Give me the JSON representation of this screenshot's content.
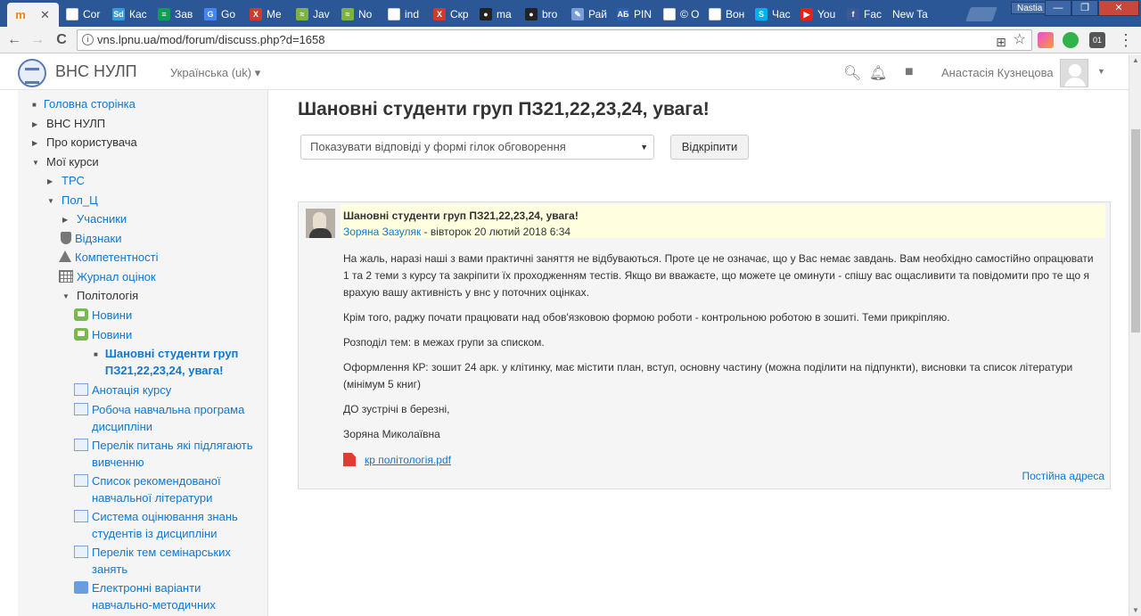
{
  "browser": {
    "tabs": [
      {
        "label": "",
        "icon": "moodle-icon",
        "color": "#f98012",
        "glyph": "m",
        "active": true
      },
      {
        "label": "Cor",
        "icon": "document-icon",
        "color": "#ffffff",
        "glyph": ""
      },
      {
        "label": "Кас",
        "icon": "sd-icon",
        "color": "#3a9ad9",
        "glyph": "Sd"
      },
      {
        "label": "Зав",
        "icon": "sheets-icon",
        "color": "#0f9d58",
        "glyph": "≡"
      },
      {
        "label": "Go",
        "icon": "google-translate-icon",
        "color": "#4285f4",
        "glyph": "G"
      },
      {
        "label": "Me",
        "icon": "x-icon",
        "color": "#d23a2c",
        "glyph": "X"
      },
      {
        "label": "Jav",
        "icon": "learn-icon",
        "color": "#7cb342",
        "glyph": "≈"
      },
      {
        "label": "No",
        "icon": "learn-icon",
        "color": "#7cb342",
        "glyph": "≈"
      },
      {
        "label": "ind",
        "icon": "document-icon",
        "color": "#ffffff",
        "glyph": ""
      },
      {
        "label": "Скр",
        "icon": "x-icon",
        "color": "#d23a2c",
        "glyph": "X"
      },
      {
        "label": "ma",
        "icon": "github-icon",
        "color": "#222222",
        "glyph": "●"
      },
      {
        "label": "bro",
        "icon": "github-icon",
        "color": "#222222",
        "glyph": "●"
      },
      {
        "label": "Рай",
        "icon": "pen-icon",
        "color": "#7a9ed8",
        "glyph": "✎"
      },
      {
        "label": "PIN",
        "icon": "ab-icon",
        "color": "#2b5fb3",
        "glyph": "АБ"
      },
      {
        "label": "© Ο",
        "icon": "document-icon",
        "color": "#ffffff",
        "glyph": ""
      },
      {
        "label": "Вон",
        "icon": "document-icon",
        "color": "#ffffff",
        "glyph": ""
      },
      {
        "label": "Час",
        "icon": "skype-icon",
        "color": "#00aff0",
        "glyph": "S"
      },
      {
        "label": "You",
        "icon": "youtube-icon",
        "color": "#e62117",
        "glyph": "▶"
      },
      {
        "label": "Fac",
        "icon": "facebook-icon",
        "color": "#3b5998",
        "glyph": "f"
      },
      {
        "label": "New Ta",
        "icon": "",
        "color": "",
        "glyph": ""
      }
    ],
    "user_badge": "Nastia",
    "window_buttons": [
      "—",
      "❐",
      "✕"
    ],
    "url": "vns.lpnu.ua/mod/forum/discuss.php?d=1658",
    "nav_back": "←",
    "nav_forward": "→",
    "nav_reload": "C",
    "info_glyph": "i",
    "omni_translate_glyph": "⊞",
    "omni_star_glyph": "☆",
    "ext_label_01": "01",
    "menu_glyph": "⋮"
  },
  "topbar": {
    "brand": "ВНС НУЛП",
    "language": "Українська (uk) ▾",
    "user_name": "Анастасія Кузнецова",
    "search_glyph": "🔍︎",
    "bell_glyph": "🔔︎",
    "chat_glyph": "■",
    "caret_glyph": "▼"
  },
  "sidebar": {
    "items": [
      {
        "label": "Головна сторінка",
        "kind": "bullet"
      },
      {
        "label": "ВНС НУЛП",
        "kind": "collapsed"
      },
      {
        "label": "Про користувача",
        "kind": "collapsed"
      },
      {
        "label": "Мої курси",
        "kind": "expanded"
      },
      {
        "label": "ТРС",
        "kind": "collapsed"
      },
      {
        "label": "Пол_Ц",
        "kind": "expanded"
      },
      {
        "label": "Учасники",
        "kind": "collapsed"
      },
      {
        "label": "Відзнаки",
        "icon": "trophy-icon"
      },
      {
        "label": "Компетентності",
        "icon": "competency-icon"
      },
      {
        "label": "Журнал оцінок",
        "icon": "gradebook-icon"
      },
      {
        "label": "Політологія",
        "kind": "expanded"
      },
      {
        "label": "Новини",
        "icon": "forum-icon"
      },
      {
        "label": "Новини",
        "icon": "forum-icon"
      },
      {
        "label": "Шановні студенти груп ПЗ21,22,23,24, увага!",
        "kind": "current"
      },
      {
        "label": "Анотація курсу",
        "icon": "page-icon"
      },
      {
        "label": "Робоча навчальна програма дисципліни",
        "icon": "page-icon"
      },
      {
        "label": "Перелік питань які підлягають вивченню",
        "icon": "page-icon"
      },
      {
        "label": "Список рекомендованої навчальної літератури",
        "icon": "page-icon"
      },
      {
        "label": "Система оцінювання знань студентів із дисципліни",
        "icon": "page-icon"
      },
      {
        "label": "Перелік тем семінарських занять",
        "icon": "page-icon"
      },
      {
        "label": "Електронні варіанти навчально-методичних",
        "icon": "folder-icon"
      }
    ],
    "glyphs": {
      "collapsed": "▶",
      "expanded": "▼",
      "bullet": "■"
    }
  },
  "main": {
    "title": "Шановні студенти груп ПЗ21,22,23,24, увага!",
    "display_mode": "Показувати відповіді у формі гілок обговорення",
    "display_mode_arrow": "▼",
    "pin_button": "Відкріпити",
    "post": {
      "subject": "Шановні студенти груп ПЗ21,22,23,24, увага!",
      "author": "Зоряна Зазуляк",
      "date": " - вівторок 20 лютий 2018 6:34",
      "paragraphs": [
        "На жаль, наразі наші з вами практичні заняття не відбуваються. Проте це не означає, що у Вас немає завдань. Вам необхідно самостійно опрацювати 1 та 2 теми з курсу та закріпити їх проходженням тестів. Якщо ви вважаєте, що можете це оминути - спішу вас ощасливити та повідомити про те що я врахую вашу активність у внс у поточних оцінках.",
        "Крім того, раджу почати працювати над обов'язковою формою роботи - контрольною роботою в зошиті. Теми прикріпляю.",
        "Розподіл тем: в межах групи за списком.",
        "Оформлення КР: зошит 24 арк. у клітинку, має містити план, вступ, основну частину (можна поділити на підпункти), висновки та список літератури (мінімум 5 книг)",
        "ДО зустрічі в березні,",
        "Зоряна Миколаївна"
      ],
      "attachment": "кр політологія.pdf",
      "permalink": "Постійна адреса"
    }
  },
  "colors": {
    "link": "#1177d1",
    "post_header": "#ffffe0",
    "chrome_blue": "#2b5797"
  }
}
